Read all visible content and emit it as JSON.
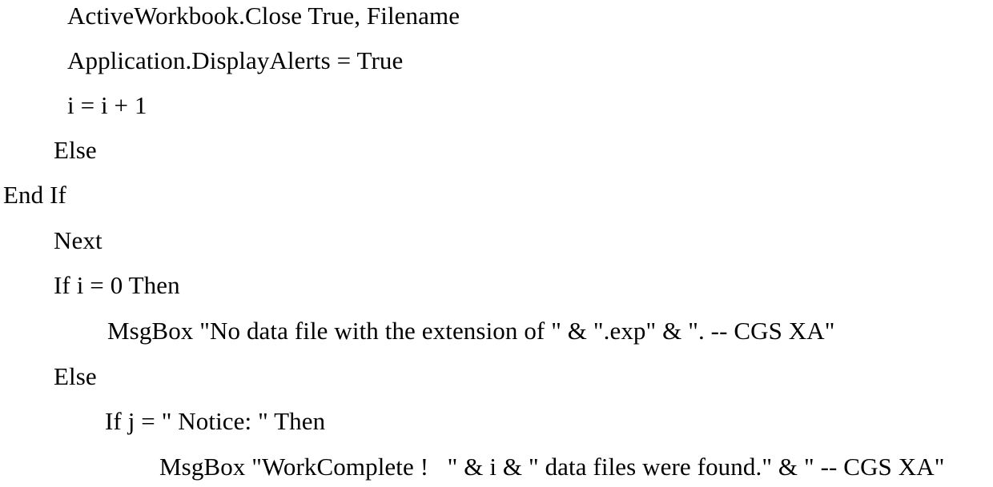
{
  "document": {
    "type": "source-code-listing",
    "language": "VBA",
    "background_color": "#ffffff",
    "text_color": "#000000",
    "lines": [
      {
        "text": "ActiveWorkbook.Close True, Filename",
        "indent_level": 2
      },
      {
        "text": "Application.DisplayAlerts = True",
        "indent_level": 2
      },
      {
        "text": "i = i + 1",
        "indent_level": 2
      },
      {
        "text": "Else",
        "indent_level": 1
      },
      {
        "text": "End If",
        "indent_level": 0
      },
      {
        "text": "Next",
        "indent_level": 1
      },
      {
        "text": "If i = 0 Then",
        "indent_level": 1
      },
      {
        "text": "MsgBox \"No data file with the extension of \" & \".exp\" & \". -- CGS XA\"",
        "indent_level": 4
      },
      {
        "text": "Else",
        "indent_level": 1
      },
      {
        "text": "If j = \" Notice: \" Then",
        "indent_level": 3
      },
      {
        "text": "MsgBox \"WorkComplete !   \" & i & \" data files were found.\" & \" -- CGS XA\"",
        "indent_level": 5
      }
    ]
  }
}
